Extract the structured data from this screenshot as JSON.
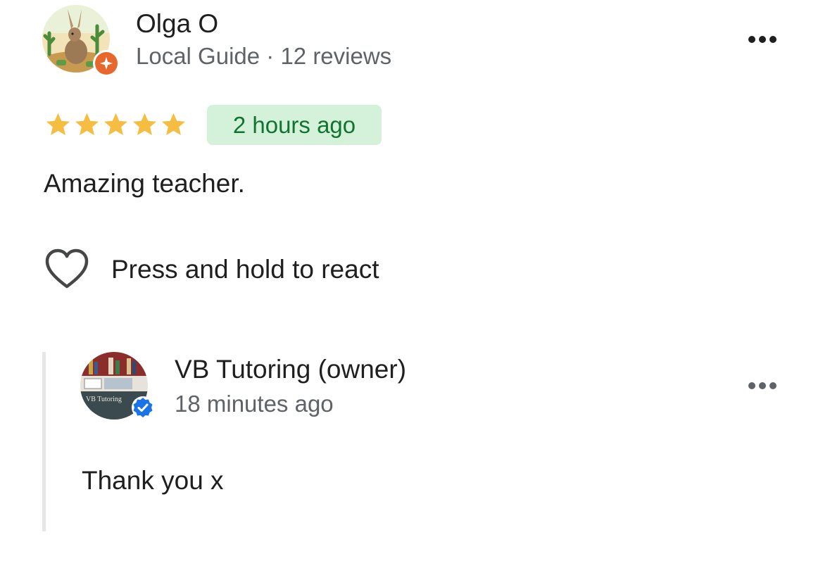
{
  "review": {
    "author": {
      "name": "Olga O",
      "meta": "Local Guide · 12 reviews",
      "avatar_icon": "jackrabbit-desert-avatar",
      "badge_icon": "local-guide-badge-icon",
      "badge_color": "#e8672c"
    },
    "rating": 5,
    "rating_max": 5,
    "star_color": "#f5bd41",
    "time": "2 hours ago",
    "time_chip_bg": "#d3f2d9",
    "time_chip_fg": "#137333",
    "text": "Amazing teacher.",
    "react_label": "Press and hold to react",
    "react_icon": "heart-outline-icon",
    "more_icon": "more-horizontal-icon"
  },
  "owner_reply": {
    "name": "VB Tutoring (owner)",
    "time": "18 minutes ago",
    "text": "Thank you x",
    "avatar_icon": "bookshelf-logo-avatar",
    "verified_icon": "verified-check-icon",
    "verified_color": "#1a73e8",
    "more_icon": "more-horizontal-icon"
  }
}
